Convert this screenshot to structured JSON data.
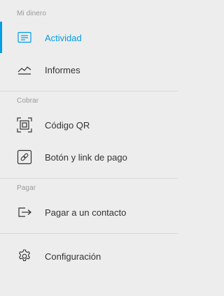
{
  "colors": {
    "background": "#ededed",
    "accent": "#009ee3",
    "text": "#333333",
    "section_title": "#999999",
    "divider": "#d8d8d8"
  },
  "sections": [
    {
      "title": "Mi dinero",
      "items": [
        {
          "label": "Actividad",
          "icon": "activity-list-icon",
          "active": true
        },
        {
          "label": "Informes",
          "icon": "reports-chart-icon",
          "active": false
        }
      ]
    },
    {
      "title": "Cobrar",
      "items": [
        {
          "label": "Código QR",
          "icon": "qr-code-icon",
          "active": false
        },
        {
          "label": "Botón y link de pago",
          "icon": "payment-link-icon",
          "active": false
        }
      ]
    },
    {
      "title": "Pagar",
      "items": [
        {
          "label": "Pagar a un contacto",
          "icon": "send-payment-icon",
          "active": false
        }
      ]
    }
  ],
  "footer_item": {
    "label": "Configuración",
    "icon": "gear-icon",
    "active": false
  }
}
